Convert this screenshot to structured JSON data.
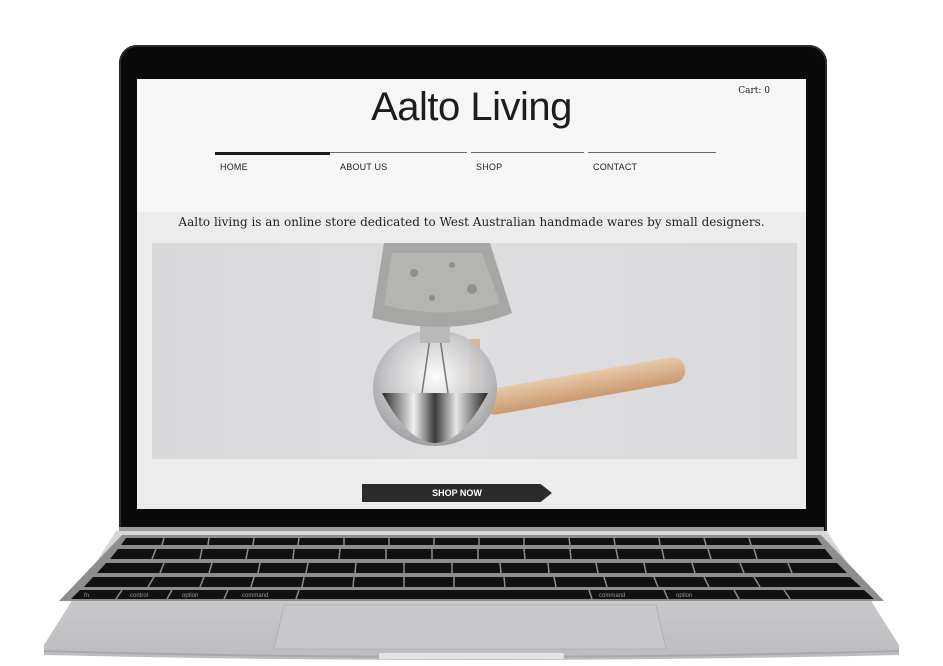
{
  "site": {
    "brand": "Aalto Living",
    "cart_label": "Cart: 0",
    "nav": [
      {
        "label": "HOME",
        "active": true
      },
      {
        "label": "ABOUT US"
      },
      {
        "label": "SHOP"
      },
      {
        "label": "CONTACT"
      }
    ],
    "tagline": "Aalto living is an online store dedicated to West Australian handmade wares by small designers.",
    "cta_label": "SHOP NOW"
  },
  "keyboard": {
    "labels": [
      "fn",
      "control",
      "option",
      "command",
      "command",
      "option"
    ]
  },
  "colors": {
    "accent": "#1a1a1a",
    "page_bg": "#f6f6f6",
    "hero_bg": "#dcdcde",
    "button_bg": "#2a2a2a"
  },
  "icons": [
    "pendant-lamp-icon",
    "laptop-icon"
  ]
}
